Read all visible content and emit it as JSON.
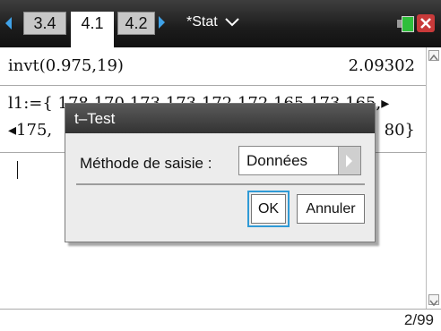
{
  "topbar": {
    "tabs": [
      {
        "label": "3.4",
        "active": false
      },
      {
        "label": "4.1",
        "active": true
      },
      {
        "label": "4.2",
        "active": false
      }
    ],
    "document_title": "*Stat",
    "accent_color": "#3fa2e8"
  },
  "calculator": {
    "history": [
      {
        "input": "invt(0.975,19)",
        "result": "2.09302"
      },
      {
        "input": "l1:={ 178,170,173,173,172,172,165,173,165,▸"
      },
      {
        "input": "◂175,",
        "result": "80}"
      }
    ]
  },
  "dialog": {
    "title": "t–Test",
    "field_label": "Méthode de saisie :",
    "field_value": "Données",
    "ok_label": "OK",
    "cancel_label": "Annuler"
  },
  "status": {
    "page_counter": "2/99"
  },
  "icons": {
    "prev_tab": "left-arrow-icon",
    "next_tab": "right-arrow-icon",
    "menu": "chevron-down-icon",
    "battery": "battery-icon",
    "close": "close-icon",
    "scroll_up": "scroll-up-icon",
    "scroll_down": "scroll-down-icon"
  }
}
